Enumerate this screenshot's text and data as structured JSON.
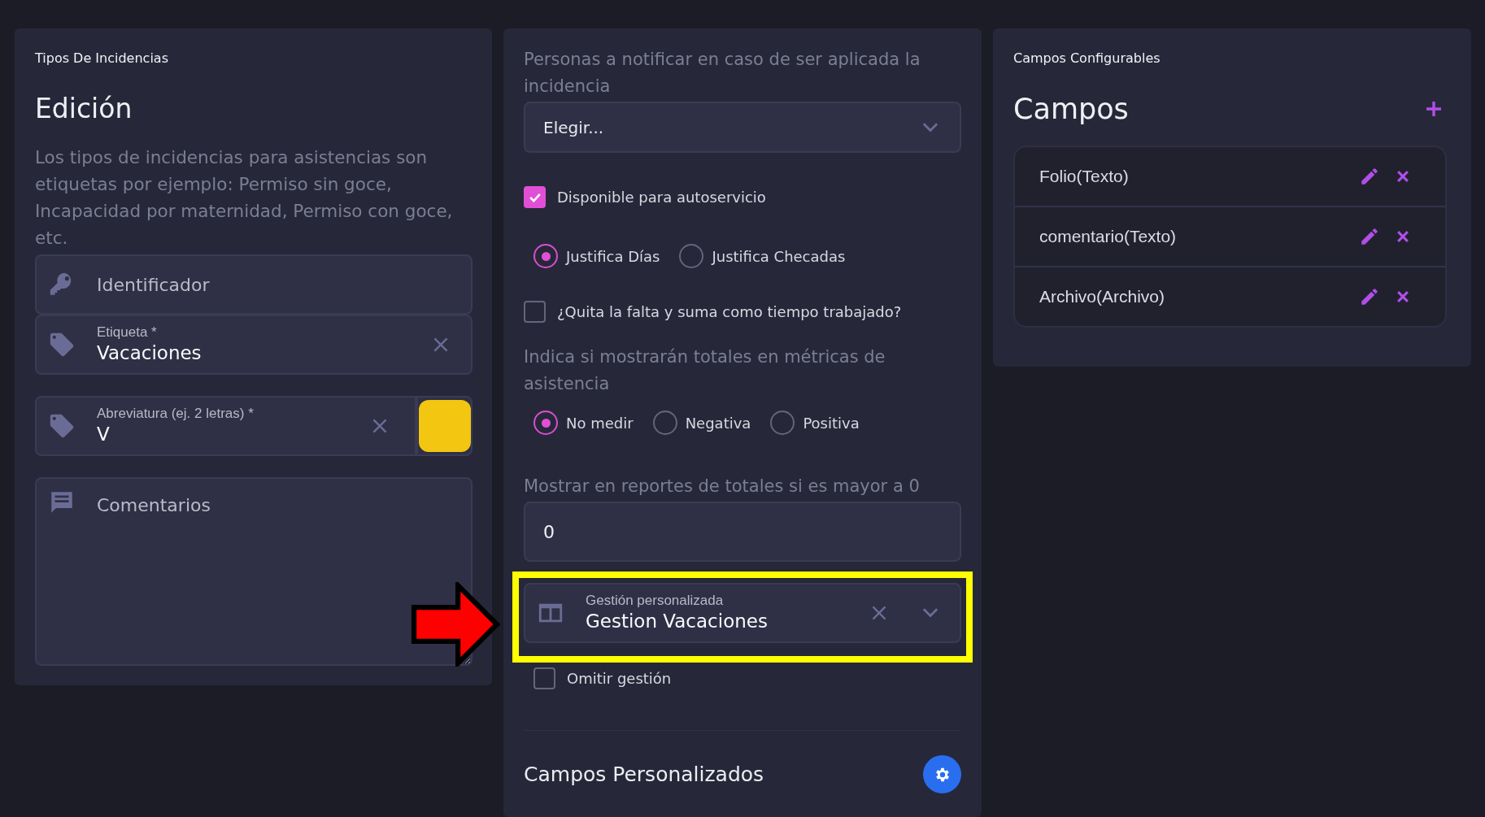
{
  "left_panel": {
    "subtitle": "Tipos De Incidencias",
    "title": "Edición",
    "description": "Los tipos de incidencias para asistencias son etiquetas por ejemplo: Permiso sin goce, Incapacidad por maternidad, Permiso con goce, etc.",
    "identifier_field": {
      "placeholder": "Identificador"
    },
    "label_field": {
      "label": "Etiqueta *",
      "value": "Vacaciones"
    },
    "abbreviation_field": {
      "label": "Abreviatura (ej. 2 letras) *",
      "value": "V",
      "color": "#f2c611"
    },
    "comments_field": {
      "placeholder": "Comentarios"
    }
  },
  "middle_panel": {
    "notify_label": "Personas a notificar en caso de ser aplicada la incidencia",
    "notify_select": {
      "placeholder": "Elegir..."
    },
    "self_service": {
      "label": "Disponible para autoservicio",
      "checked": true
    },
    "justify_options": [
      {
        "label": "Justifica Días",
        "selected": true
      },
      {
        "label": "Justifica Checadas",
        "selected": false
      }
    ],
    "worked_time": {
      "label": "¿Quita la falta y suma como tiempo trabajado?",
      "checked": false
    },
    "metrics_label": "Indica si mostrarán totales en métricas de asistencia",
    "metrics_options": [
      {
        "label": "No medir",
        "selected": true
      },
      {
        "label": "Negativa",
        "selected": false
      },
      {
        "label": "Positiva",
        "selected": false
      }
    ],
    "totals_label": "Mostrar en reportes de totales si es mayor a 0",
    "totals_input": {
      "value": "0"
    },
    "custom_management": {
      "label": "Gestión personalizada",
      "value": "Gestion Vacaciones",
      "highlighted": true
    },
    "omit_management": {
      "label": "Omitir gestión",
      "checked": false
    },
    "custom_fields_title": "Campos Personalizados"
  },
  "right_panel": {
    "subtitle": "Campos Configurables",
    "title": "Campos",
    "fields": [
      {
        "name": "Folio(Texto)"
      },
      {
        "name": "comentario(Texto)"
      },
      {
        "name": "Archivo(Archivo)"
      }
    ]
  }
}
